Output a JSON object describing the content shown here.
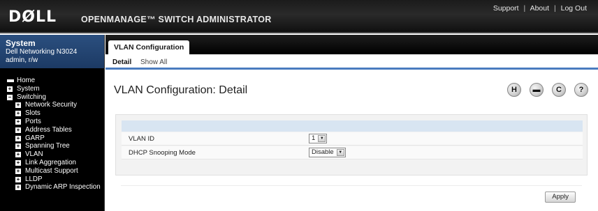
{
  "header": {
    "logo": "DØLL",
    "app_title": "OPENMANAGE™ SWITCH ADMINISTRATOR",
    "links": [
      "Support",
      "About",
      "Log Out"
    ],
    "separator": "|"
  },
  "sidebar": {
    "system_title": "System",
    "system_model": "Dell Networking N3024",
    "user": "admin, r/w",
    "tree": [
      {
        "label": "Home",
        "level": 0,
        "expander": "home"
      },
      {
        "label": "System",
        "level": 0,
        "expander": "+"
      },
      {
        "label": "Switching",
        "level": 0,
        "expander": "−"
      },
      {
        "label": "Network Security",
        "level": 1,
        "expander": "+"
      },
      {
        "label": "Slots",
        "level": 1,
        "expander": "+"
      },
      {
        "label": "Ports",
        "level": 1,
        "expander": "+"
      },
      {
        "label": "Address Tables",
        "level": 1,
        "expander": "+"
      },
      {
        "label": "GARP",
        "level": 1,
        "expander": "+"
      },
      {
        "label": "Spanning Tree",
        "level": 1,
        "expander": "+"
      },
      {
        "label": "VLAN",
        "level": 1,
        "expander": "+"
      },
      {
        "label": "Link Aggregation",
        "level": 1,
        "expander": "+"
      },
      {
        "label": "Multicast Support",
        "level": 1,
        "expander": "+"
      },
      {
        "label": "LLDP",
        "level": 1,
        "expander": "+"
      },
      {
        "label": "Dynamic ARP Inspection",
        "level": 1,
        "expander": "+"
      }
    ]
  },
  "tabs": {
    "active": "VLAN Configuration"
  },
  "subtabs": {
    "active": "Detail",
    "other": "Show All"
  },
  "main": {
    "title": "VLAN Configuration: Detail",
    "tools": [
      {
        "icon": "help-h-icon",
        "glyph": "H"
      },
      {
        "icon": "print-icon",
        "glyph": "▬"
      },
      {
        "icon": "refresh-icon",
        "glyph": "C"
      },
      {
        "icon": "question-icon",
        "glyph": "?"
      }
    ],
    "form": {
      "vlan_id_label": "VLAN ID",
      "vlan_id_value": "1",
      "dhcp_label": "DHCP Snooping Mode",
      "dhcp_value": "Disable"
    },
    "apply_label": "Apply"
  },
  "colors": {
    "header_bg": "#1b1b1b",
    "sidebar_bg": "#000000",
    "system_box": "#2b4f7f",
    "accent_line": "#4a7cbf",
    "form_header": "#d8e5f2"
  }
}
